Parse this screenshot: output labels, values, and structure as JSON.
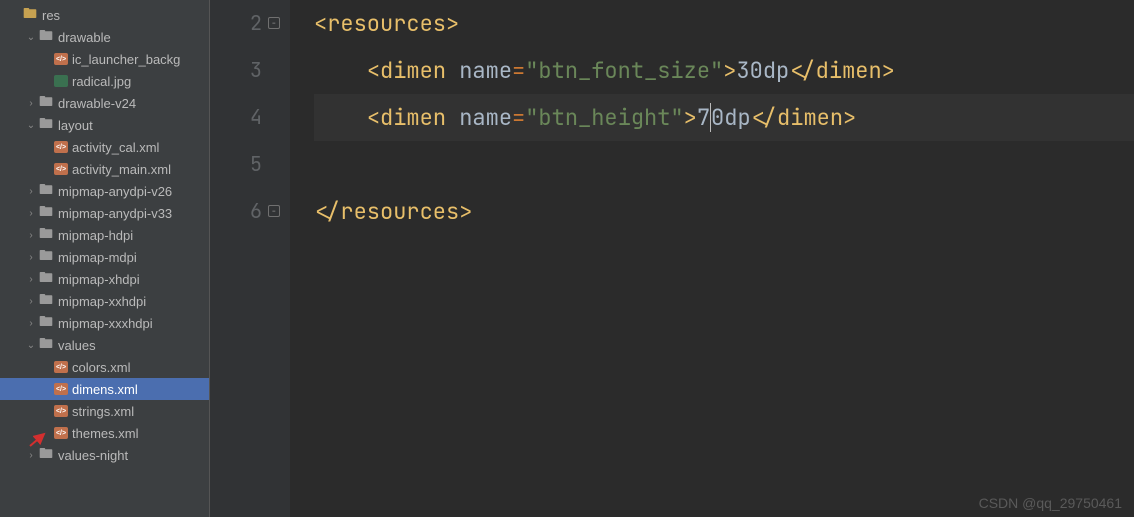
{
  "sidebar": {
    "items": [
      {
        "indent": 0,
        "arrow": "none",
        "icon": "res",
        "label": "res"
      },
      {
        "indent": 1,
        "arrow": "down",
        "icon": "folder",
        "label": "drawable"
      },
      {
        "indent": 2,
        "arrow": "none",
        "icon": "xml",
        "label": "ic_launcher_backg"
      },
      {
        "indent": 2,
        "arrow": "none",
        "icon": "img",
        "label": "radical.jpg"
      },
      {
        "indent": 1,
        "arrow": "right",
        "icon": "folder",
        "label": "drawable-v24"
      },
      {
        "indent": 1,
        "arrow": "down",
        "icon": "folder",
        "label": "layout"
      },
      {
        "indent": 2,
        "arrow": "none",
        "icon": "xml",
        "label": "activity_cal.xml"
      },
      {
        "indent": 2,
        "arrow": "none",
        "icon": "xml",
        "label": "activity_main.xml"
      },
      {
        "indent": 1,
        "arrow": "right",
        "icon": "folder",
        "label": "mipmap-anydpi-v26"
      },
      {
        "indent": 1,
        "arrow": "right",
        "icon": "folder",
        "label": "mipmap-anydpi-v33"
      },
      {
        "indent": 1,
        "arrow": "right",
        "icon": "folder",
        "label": "mipmap-hdpi"
      },
      {
        "indent": 1,
        "arrow": "right",
        "icon": "folder",
        "label": "mipmap-mdpi"
      },
      {
        "indent": 1,
        "arrow": "right",
        "icon": "folder",
        "label": "mipmap-xhdpi"
      },
      {
        "indent": 1,
        "arrow": "right",
        "icon": "folder",
        "label": "mipmap-xxhdpi"
      },
      {
        "indent": 1,
        "arrow": "right",
        "icon": "folder",
        "label": "mipmap-xxxhdpi"
      },
      {
        "indent": 1,
        "arrow": "down",
        "icon": "folder",
        "label": "values"
      },
      {
        "indent": 2,
        "arrow": "none",
        "icon": "xml",
        "label": "colors.xml"
      },
      {
        "indent": 2,
        "arrow": "none",
        "icon": "xml",
        "label": "dimens.xml",
        "selected": true,
        "pointed": true
      },
      {
        "indent": 2,
        "arrow": "none",
        "icon": "xml",
        "label": "strings.xml"
      },
      {
        "indent": 2,
        "arrow": "none",
        "icon": "xml",
        "label": "themes.xml"
      },
      {
        "indent": 1,
        "arrow": "right",
        "icon": "folder",
        "label": "values-night"
      }
    ]
  },
  "editor": {
    "gutter": [
      "2",
      "3",
      "4",
      "5",
      "6"
    ],
    "code": {
      "line2": {
        "open": "<resources>",
        "close": ""
      },
      "line3": {
        "tag_open": "<dimen ",
        "attr": "name",
        "eq": "=",
        "str": "\"btn_font_size\"",
        "gt": ">",
        "val": "30dp",
        "tag_close": "</dimen>"
      },
      "line4": {
        "tag_open": "<dimen ",
        "attr": "name",
        "eq": "=",
        "str": "\"btn_height\"",
        "gt": ">",
        "val_before": "7",
        "val_after": "0dp",
        "tag_close": "</dimen>"
      },
      "line6": {
        "close": "</resources>"
      }
    }
  },
  "watermark": "CSDN @qq_29750461"
}
